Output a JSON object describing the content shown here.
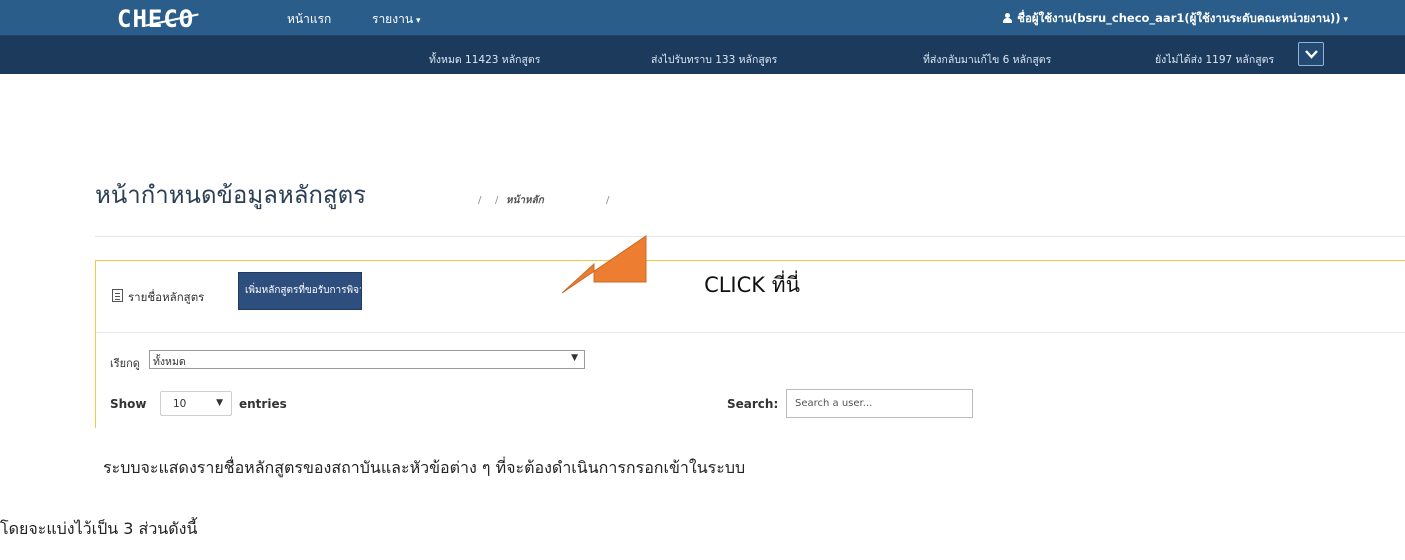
{
  "app": {
    "brand": "CHECO"
  },
  "nav": {
    "home": "หน้าแรก",
    "report": "รายงาน",
    "user": "ชื่อผู้ใช้งาน(bsru_checo_aar1(ผู้ใช้งานระดับคณะหน่วยงาน))"
  },
  "stats": {
    "all": "ทั้งหมด 11423 หลักสูตร",
    "sent": "ส่งไปรับทราบ 133 หลักสูตร",
    "returned": "ที่ส่งกลับมาแก้ไข 6 หลักสูตร",
    "unsent": "ยังไม่ได้ส่ง 1197 หลักสูตร"
  },
  "page": {
    "title": "หน้ากำหนดข้อมูลหลักสูตร",
    "breadcrumb_sep": "/",
    "breadcrumb_current": "หน้าหลัก"
  },
  "panel": {
    "heading": "รายชื่อหลักสูตร",
    "add_button": "เพิ่มหลักสูตรที่ขอรับการพิจารณาความสอดคล้อง",
    "filter_label": "เรียกดู",
    "filter_value": "ทั้งหมด",
    "show_label": "Show",
    "length_value": "10",
    "entries_label": "entries",
    "search_label": "Search:",
    "search_placeholder": "Search a user..."
  },
  "annotation": {
    "text": "CLICK ที่นี่",
    "color": "#ed7d31"
  },
  "caption": {
    "line1": "ระบบจะแสดงรายชื่อหลักสูตรของสถาบันและหัวข้อต่าง ๆ ที่จะต้องดำเนินการกรอกเข้าในระบบ",
    "line2": "โดยจะแบ่งไว้เป็น 3 ส่วนดังนี้"
  }
}
